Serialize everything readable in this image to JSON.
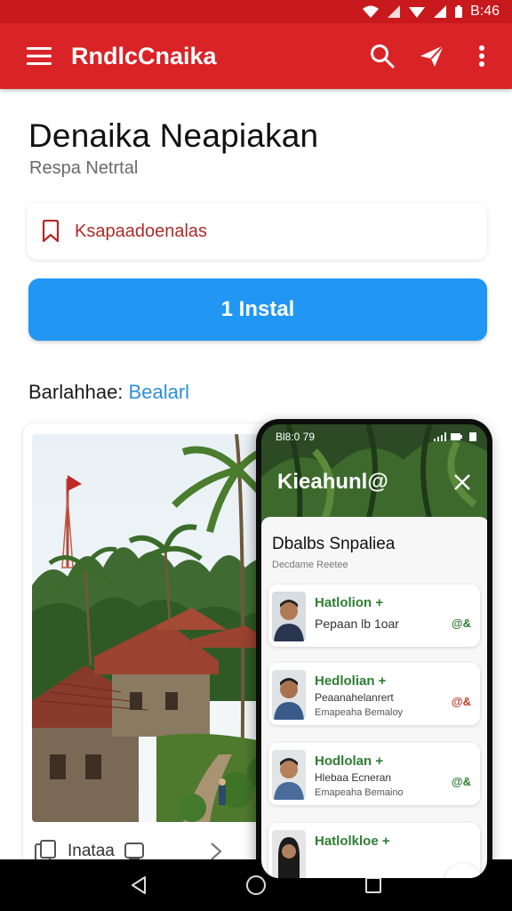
{
  "status_bar": {
    "time": "B:46"
  },
  "app_bar": {
    "title": "RndlcCnaika",
    "icons": [
      "menu-icon",
      "search-icon",
      "send-icon",
      "more-vert-icon"
    ]
  },
  "app": {
    "title": "Denaika Neapiakan",
    "subtitle": "Respa Netrtal",
    "tag_label": "Ksapaadoenalas",
    "install_label": "1 Instal"
  },
  "section": {
    "heading_prefix": "Barlahhae:",
    "heading_accent": "Bealarl"
  },
  "image_card": {
    "footer_label": "Inataa"
  },
  "phone": {
    "status_time": "Bl8:0 79",
    "header_title": "Kieahunl@",
    "sheet_title": "Dbalbs Snpaliea",
    "sheet_subtitle": "Decdame Reetee",
    "people": [
      {
        "name": "Hatlolion +",
        "detail": "Pepaan lb 1oar",
        "detail2": "",
        "badge": "@&"
      },
      {
        "name": "Hedlolian +",
        "detail": "Peaanahelanrert",
        "detail2": "Emapeaha Bemaloy",
        "badge": "@&"
      },
      {
        "name": "Hodlolan +",
        "detail": "Hlebaa Ecneran",
        "detail2": "Emapeaha Bemaino",
        "badge": "@&"
      },
      {
        "name": "Hatlolkloe +",
        "detail": "",
        "detail2": "",
        "badge": ""
      }
    ]
  },
  "colors": {
    "app_bar": "#d92327",
    "status_bar": "#c8191c",
    "install_button": "#2196f3",
    "accent_text": "#2b8fd6",
    "name_green": "#2e7d32"
  }
}
